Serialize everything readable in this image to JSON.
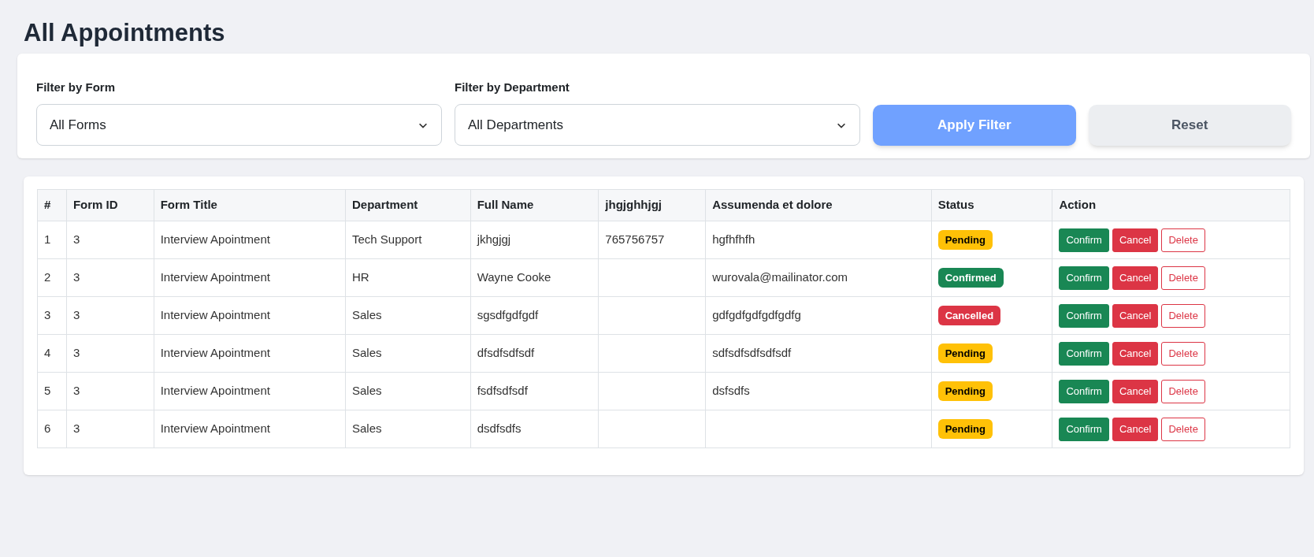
{
  "title": "All Appointments",
  "filters": [
    {
      "label": "Filter by Form",
      "value": "All Forms"
    },
    {
      "label": "Filter by Department",
      "value": "All Departments"
    }
  ],
  "buttons": [
    {
      "label": "Apply Filter",
      "kind": "primary"
    },
    {
      "label": "Reset",
      "kind": "secondary"
    }
  ],
  "table": {
    "columns": [
      "#",
      "Form ID",
      "Form Title",
      "Department",
      "Full Name",
      "jhgjghhjgj",
      "Assumenda et dolore",
      "Status",
      "Action"
    ],
    "rows": [
      {
        "cells": [
          "1",
          "3",
          "Interview Apointment",
          "Tech Support",
          "jkhgjgj",
          "765756757",
          "hgfhfhfh"
        ],
        "status": {
          "label": "Pending",
          "kind": "pending"
        },
        "actions": [
          {
            "label": "Confirm",
            "kind": "confirm"
          },
          {
            "label": "Cancel",
            "kind": "cancel"
          },
          {
            "label": "Delete",
            "kind": "delete"
          }
        ]
      },
      {
        "cells": [
          "2",
          "3",
          "Interview Apointment",
          "HR",
          "Wayne Cooke",
          "",
          "wurovala@mailinator.com"
        ],
        "status": {
          "label": "Confirmed",
          "kind": "confirmed"
        },
        "actions": [
          {
            "label": "Confirm",
            "kind": "confirm"
          },
          {
            "label": "Cancel",
            "kind": "cancel"
          },
          {
            "label": "Delete",
            "kind": "delete"
          }
        ]
      },
      {
        "cells": [
          "3",
          "3",
          "Interview Apointment",
          "Sales",
          "sgsdfgdfgdf",
          "",
          "gdfgdfgdfgdfgdfg"
        ],
        "status": {
          "label": "Cancelled",
          "kind": "cancelled"
        },
        "actions": [
          {
            "label": "Confirm",
            "kind": "confirm"
          },
          {
            "label": "Cancel",
            "kind": "cancel"
          },
          {
            "label": "Delete",
            "kind": "delete"
          }
        ]
      },
      {
        "cells": [
          "4",
          "3",
          "Interview Apointment",
          "Sales",
          "dfsdfsdfsdf",
          "",
          "sdfsdfsdfsdfsdf"
        ],
        "status": {
          "label": "Pending",
          "kind": "pending"
        },
        "actions": [
          {
            "label": "Confirm",
            "kind": "confirm"
          },
          {
            "label": "Cancel",
            "kind": "cancel"
          },
          {
            "label": "Delete",
            "kind": "delete"
          }
        ]
      },
      {
        "cells": [
          "5",
          "3",
          "Interview Apointment",
          "Sales",
          "fsdfsdfsdf",
          "",
          "dsfsdfs"
        ],
        "status": {
          "label": "Pending",
          "kind": "pending"
        },
        "actions": [
          {
            "label": "Confirm",
            "kind": "confirm"
          },
          {
            "label": "Cancel",
            "kind": "cancel"
          },
          {
            "label": "Delete",
            "kind": "delete"
          }
        ]
      },
      {
        "cells": [
          "6",
          "3",
          "Interview Apointment",
          "Sales",
          "dsdfsdfs",
          "",
          ""
        ],
        "status": {
          "label": "Pending",
          "kind": "pending"
        },
        "actions": [
          {
            "label": "Confirm",
            "kind": "confirm"
          },
          {
            "label": "Cancel",
            "kind": "cancel"
          },
          {
            "label": "Delete",
            "kind": "delete"
          }
        ]
      }
    ]
  }
}
